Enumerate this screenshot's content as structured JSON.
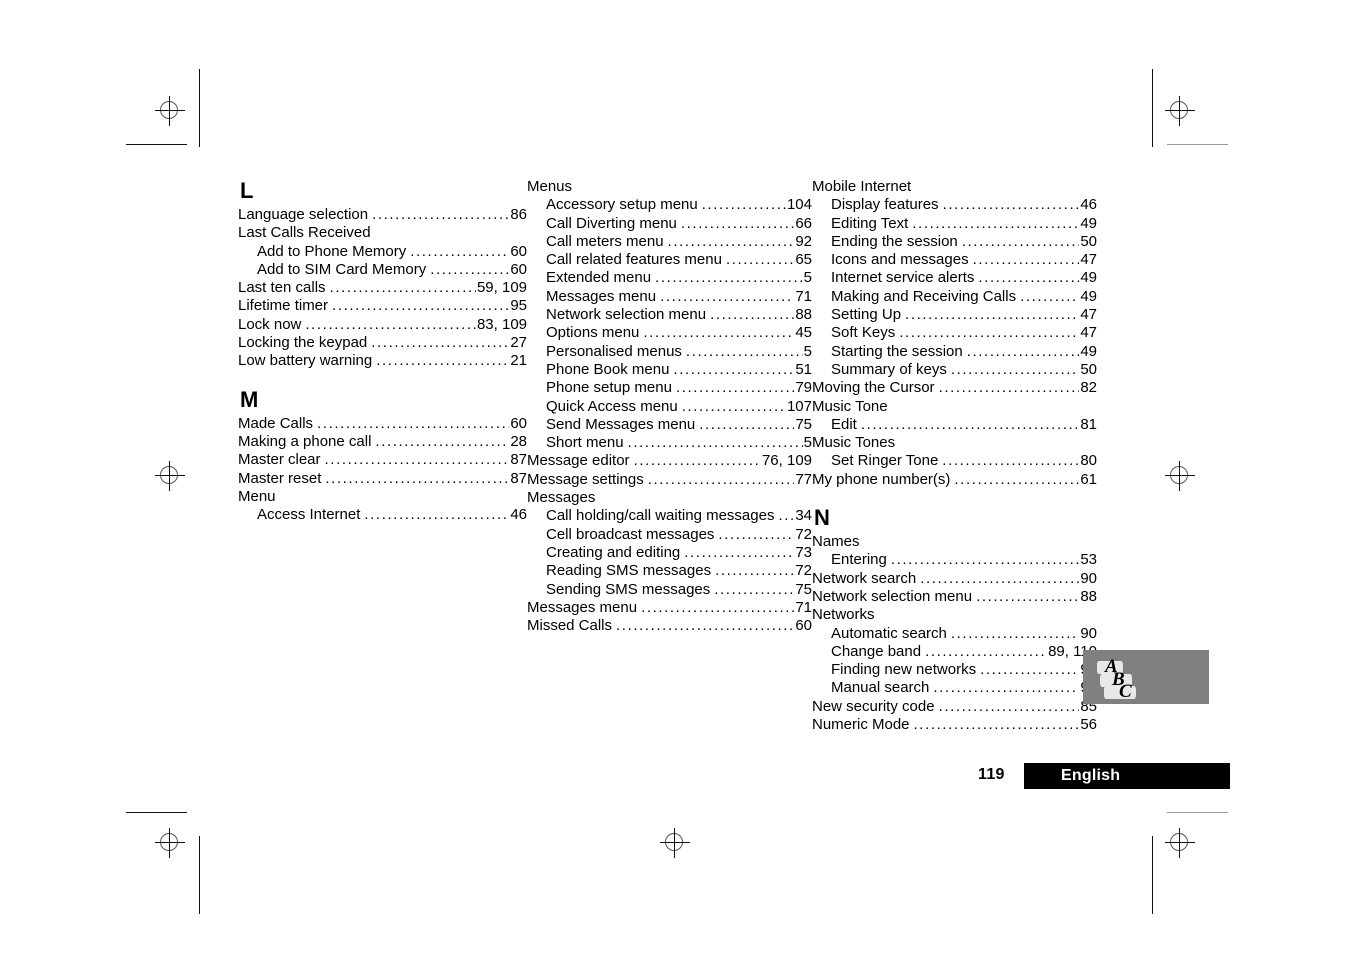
{
  "page": {
    "number": "119",
    "language_label": "English",
    "thumb_tab": {
      "letters": [
        "A",
        "B",
        "C"
      ],
      "background_color": "#808080"
    },
    "footer_bar_color": "#000000"
  },
  "columns": [
    {
      "id": "column-left",
      "blocks": [
        {
          "letter": "L",
          "entries": [
            {
              "level": 1,
              "label": "Language selection",
              "page": "86"
            },
            {
              "level": 1,
              "label": "Last Calls Received",
              "page": ""
            },
            {
              "level": 2,
              "label": "Add to Phone Memory",
              "page": "60"
            },
            {
              "level": 2,
              "label": "Add to SIM Card Memory",
              "page": "60"
            },
            {
              "level": 1,
              "label": "Last ten calls",
              "page": "59, 109"
            },
            {
              "level": 1,
              "label": "Lifetime timer",
              "page": "95"
            },
            {
              "level": 1,
              "label": "Lock now",
              "page": "83, 109"
            },
            {
              "level": 1,
              "label": "Locking the keypad",
              "page": "27"
            },
            {
              "level": 1,
              "label": "Low battery warning",
              "page": "21"
            }
          ]
        },
        {
          "letter": "M",
          "entries": [
            {
              "level": 1,
              "label": "Made Calls",
              "page": "60"
            },
            {
              "level": 1,
              "label": "Making a phone call",
              "page": "28"
            },
            {
              "level": 1,
              "label": "Master clear",
              "page": "87"
            },
            {
              "level": 1,
              "label": "Master reset",
              "page": "87"
            },
            {
              "level": 1,
              "label": "Menu",
              "page": ""
            },
            {
              "level": 2,
              "label": "Access Internet",
              "page": "46"
            }
          ]
        }
      ]
    },
    {
      "id": "column-middle",
      "blocks": [
        {
          "letter": "",
          "entries": [
            {
              "level": 1,
              "label": "Menus",
              "page": ""
            },
            {
              "level": 2,
              "label": "Accessory setup menu",
              "page": "104"
            },
            {
              "level": 2,
              "label": "Call Diverting menu",
              "page": "66"
            },
            {
              "level": 2,
              "label": "Call meters menu",
              "page": "92"
            },
            {
              "level": 2,
              "label": "Call related features menu",
              "page": "65"
            },
            {
              "level": 2,
              "label": "Extended menu",
              "page": "5"
            },
            {
              "level": 2,
              "label": "Messages menu",
              "page": "71"
            },
            {
              "level": 2,
              "label": "Network selection menu",
              "page": "88"
            },
            {
              "level": 2,
              "label": "Options menu",
              "page": "45"
            },
            {
              "level": 2,
              "label": "Personalised menus",
              "page": "5"
            },
            {
              "level": 2,
              "label": "Phone Book menu",
              "page": "51"
            },
            {
              "level": 2,
              "label": "Phone setup menu",
              "page": "79"
            },
            {
              "level": 2,
              "label": "Quick Access menu",
              "page": "107"
            },
            {
              "level": 2,
              "label": "Send Messages menu",
              "page": "75"
            },
            {
              "level": 2,
              "label": "Short menu",
              "page": "5"
            },
            {
              "level": 1,
              "label": "Message editor",
              "page": "76, 109"
            },
            {
              "level": 1,
              "label": "Message settings",
              "page": "77"
            },
            {
              "level": 1,
              "label": "Messages",
              "page": ""
            },
            {
              "level": 2,
              "label": "Call holding/call waiting messages",
              "page": "34"
            },
            {
              "level": 2,
              "label": "Cell broadcast messages",
              "page": "72"
            },
            {
              "level": 2,
              "label": "Creating and editing",
              "page": "73"
            },
            {
              "level": 2,
              "label": "Reading SMS messages",
              "page": "72"
            },
            {
              "level": 2,
              "label": "Sending SMS messages",
              "page": "75"
            },
            {
              "level": 1,
              "label": "Messages menu",
              "page": "71"
            },
            {
              "level": 1,
              "label": "Missed Calls",
              "page": "60"
            }
          ]
        }
      ]
    },
    {
      "id": "column-right",
      "blocks": [
        {
          "letter": "",
          "entries": [
            {
              "level": 1,
              "label": "Mobile Internet",
              "page": ""
            },
            {
              "level": 2,
              "label": "Display features",
              "page": "46"
            },
            {
              "level": 2,
              "label": "Editing Text",
              "page": "49"
            },
            {
              "level": 2,
              "label": "Ending the session",
              "page": "50"
            },
            {
              "level": 2,
              "label": "Icons and messages",
              "page": "47"
            },
            {
              "level": 2,
              "label": "Internet service alerts",
              "page": "49"
            },
            {
              "level": 2,
              "label": "Making and Receiving Calls",
              "page": "49"
            },
            {
              "level": 2,
              "label": "Setting Up",
              "page": "47"
            },
            {
              "level": 2,
              "label": "Soft Keys",
              "page": "47"
            },
            {
              "level": 2,
              "label": "Starting the session",
              "page": "49"
            },
            {
              "level": 2,
              "label": "Summary of keys",
              "page": "50"
            },
            {
              "level": 1,
              "label": "Moving the Cursor",
              "page": "82"
            },
            {
              "level": 1,
              "label": "Music Tone",
              "page": ""
            },
            {
              "level": 2,
              "label": "Edit",
              "page": "81"
            },
            {
              "level": 1,
              "label": "Music Tones",
              "page": ""
            },
            {
              "level": 2,
              "label": "Set Ringer Tone",
              "page": "80"
            },
            {
              "level": 1,
              "label": "My phone number(s)",
              "page": "61"
            }
          ]
        },
        {
          "letter": "N",
          "entries": [
            {
              "level": 1,
              "label": "Names",
              "page": ""
            },
            {
              "level": 2,
              "label": "Entering",
              "page": "53"
            },
            {
              "level": 1,
              "label": "Network search",
              "page": "90"
            },
            {
              "level": 1,
              "label": "Network selection menu",
              "page": "88"
            },
            {
              "level": 1,
              "label": "Networks",
              "page": ""
            },
            {
              "level": 2,
              "label": "Automatic search",
              "page": "90"
            },
            {
              "level": 2,
              "label": "Change band",
              "page": "89, 110"
            },
            {
              "level": 2,
              "label": "Finding new networks",
              "page": "91"
            },
            {
              "level": 2,
              "label": "Manual search",
              "page": "90"
            },
            {
              "level": 1,
              "label": "New security code",
              "page": "85"
            },
            {
              "level": 1,
              "label": "Numeric Mode",
              "page": "56"
            }
          ]
        }
      ]
    }
  ]
}
